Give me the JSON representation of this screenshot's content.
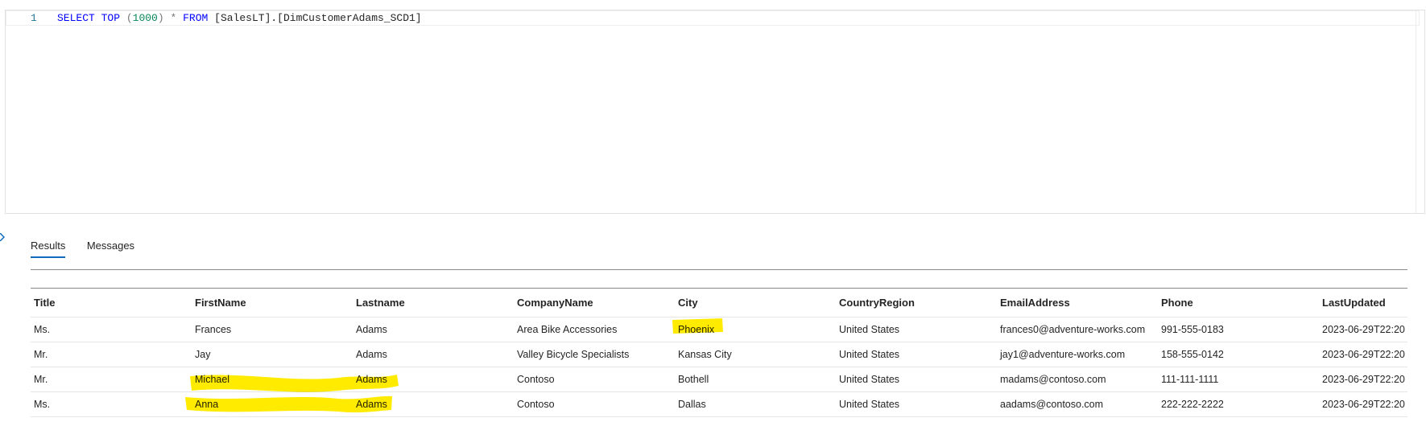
{
  "editor": {
    "line_number": "1",
    "tokens": {
      "select": "SELECT",
      "top": "TOP",
      "paren_open": "(",
      "limit": "1000",
      "paren_close": ")",
      "star": "*",
      "from": "FROM",
      "table": "[SalesLT].[DimCustomerAdams_SCD1]"
    }
  },
  "tabs": {
    "results": "Results",
    "messages": "Messages",
    "active": "results"
  },
  "grid": {
    "columns": [
      "Title",
      "FirstName",
      "Lastname",
      "CompanyName",
      "City",
      "CountryRegion",
      "EmailAddress",
      "Phone",
      "LastUpdated"
    ],
    "rows": [
      [
        "Ms.",
        "Frances",
        "Adams",
        "Area Bike Accessories",
        "Phoenix",
        "United States",
        "frances0@adventure-works.com",
        "991-555-0183",
        "2023-06-29T22:20"
      ],
      [
        "Mr.",
        "Jay",
        "Adams",
        "Valley Bicycle Specialists",
        "Kansas City",
        "United States",
        "jay1@adventure-works.com",
        "158-555-0142",
        "2023-06-29T22:20"
      ],
      [
        "Mr.",
        "Michael",
        "Adams",
        "Contoso",
        "Bothell",
        "United States",
        "madams@contoso.com",
        "111-111-1111",
        "2023-06-29T22:20"
      ],
      [
        "Ms.",
        "Anna",
        "Adams",
        "Contoso",
        "Dallas",
        "United States",
        "aadams@contoso.com",
        "222-222-2222",
        "2023-06-29T22:20"
      ]
    ]
  },
  "colors": {
    "keyword": "#0000ff",
    "number": "#098658",
    "line_number": "#237893",
    "tab_underline": "#0f6cbd",
    "highlighter": "#ffeb00"
  }
}
